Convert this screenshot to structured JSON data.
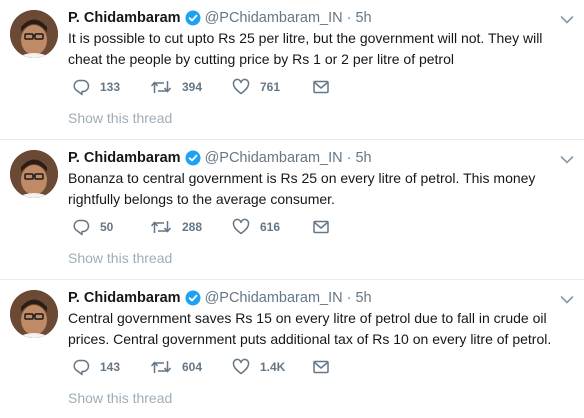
{
  "colors": {
    "verified_badge": "#1da1f2",
    "meta_text": "#657786",
    "show_thread": "#a0adb6",
    "divider": "#e6ecf0"
  },
  "icons": [
    "verified-icon",
    "chevron-down-icon",
    "reply-icon",
    "retweet-icon",
    "like-icon",
    "message-icon"
  ],
  "tweets": [
    {
      "name": "P. Chidambaram",
      "handle": "@PChidambaram_IN",
      "separator": "·",
      "time": "5h",
      "text": "It is possible to cut upto Rs 25 per litre, but the government will not. They will cheat the people by cutting price by Rs 1 or 2 per litre of petrol",
      "replies": "133",
      "retweets": "394",
      "likes": "761",
      "show_thread": "Show this thread"
    },
    {
      "name": "P. Chidambaram",
      "handle": "@PChidambaram_IN",
      "separator": "·",
      "time": "5h",
      "text": "Bonanza to central government is Rs 25 on every litre of petrol. This money rightfully belongs to the average consumer.",
      "replies": "50",
      "retweets": "288",
      "likes": "616",
      "show_thread": "Show this thread"
    },
    {
      "name": "P. Chidambaram",
      "handle": "@PChidambaram_IN",
      "separator": "·",
      "time": "5h",
      "text": "Central government saves Rs 15 on every litre of petrol due to fall in crude oil prices. Central government puts additional tax of Rs 10 on every litre of petrol.",
      "replies": "143",
      "retweets": "604",
      "likes": "1.4K",
      "show_thread": "Show this thread"
    }
  ]
}
